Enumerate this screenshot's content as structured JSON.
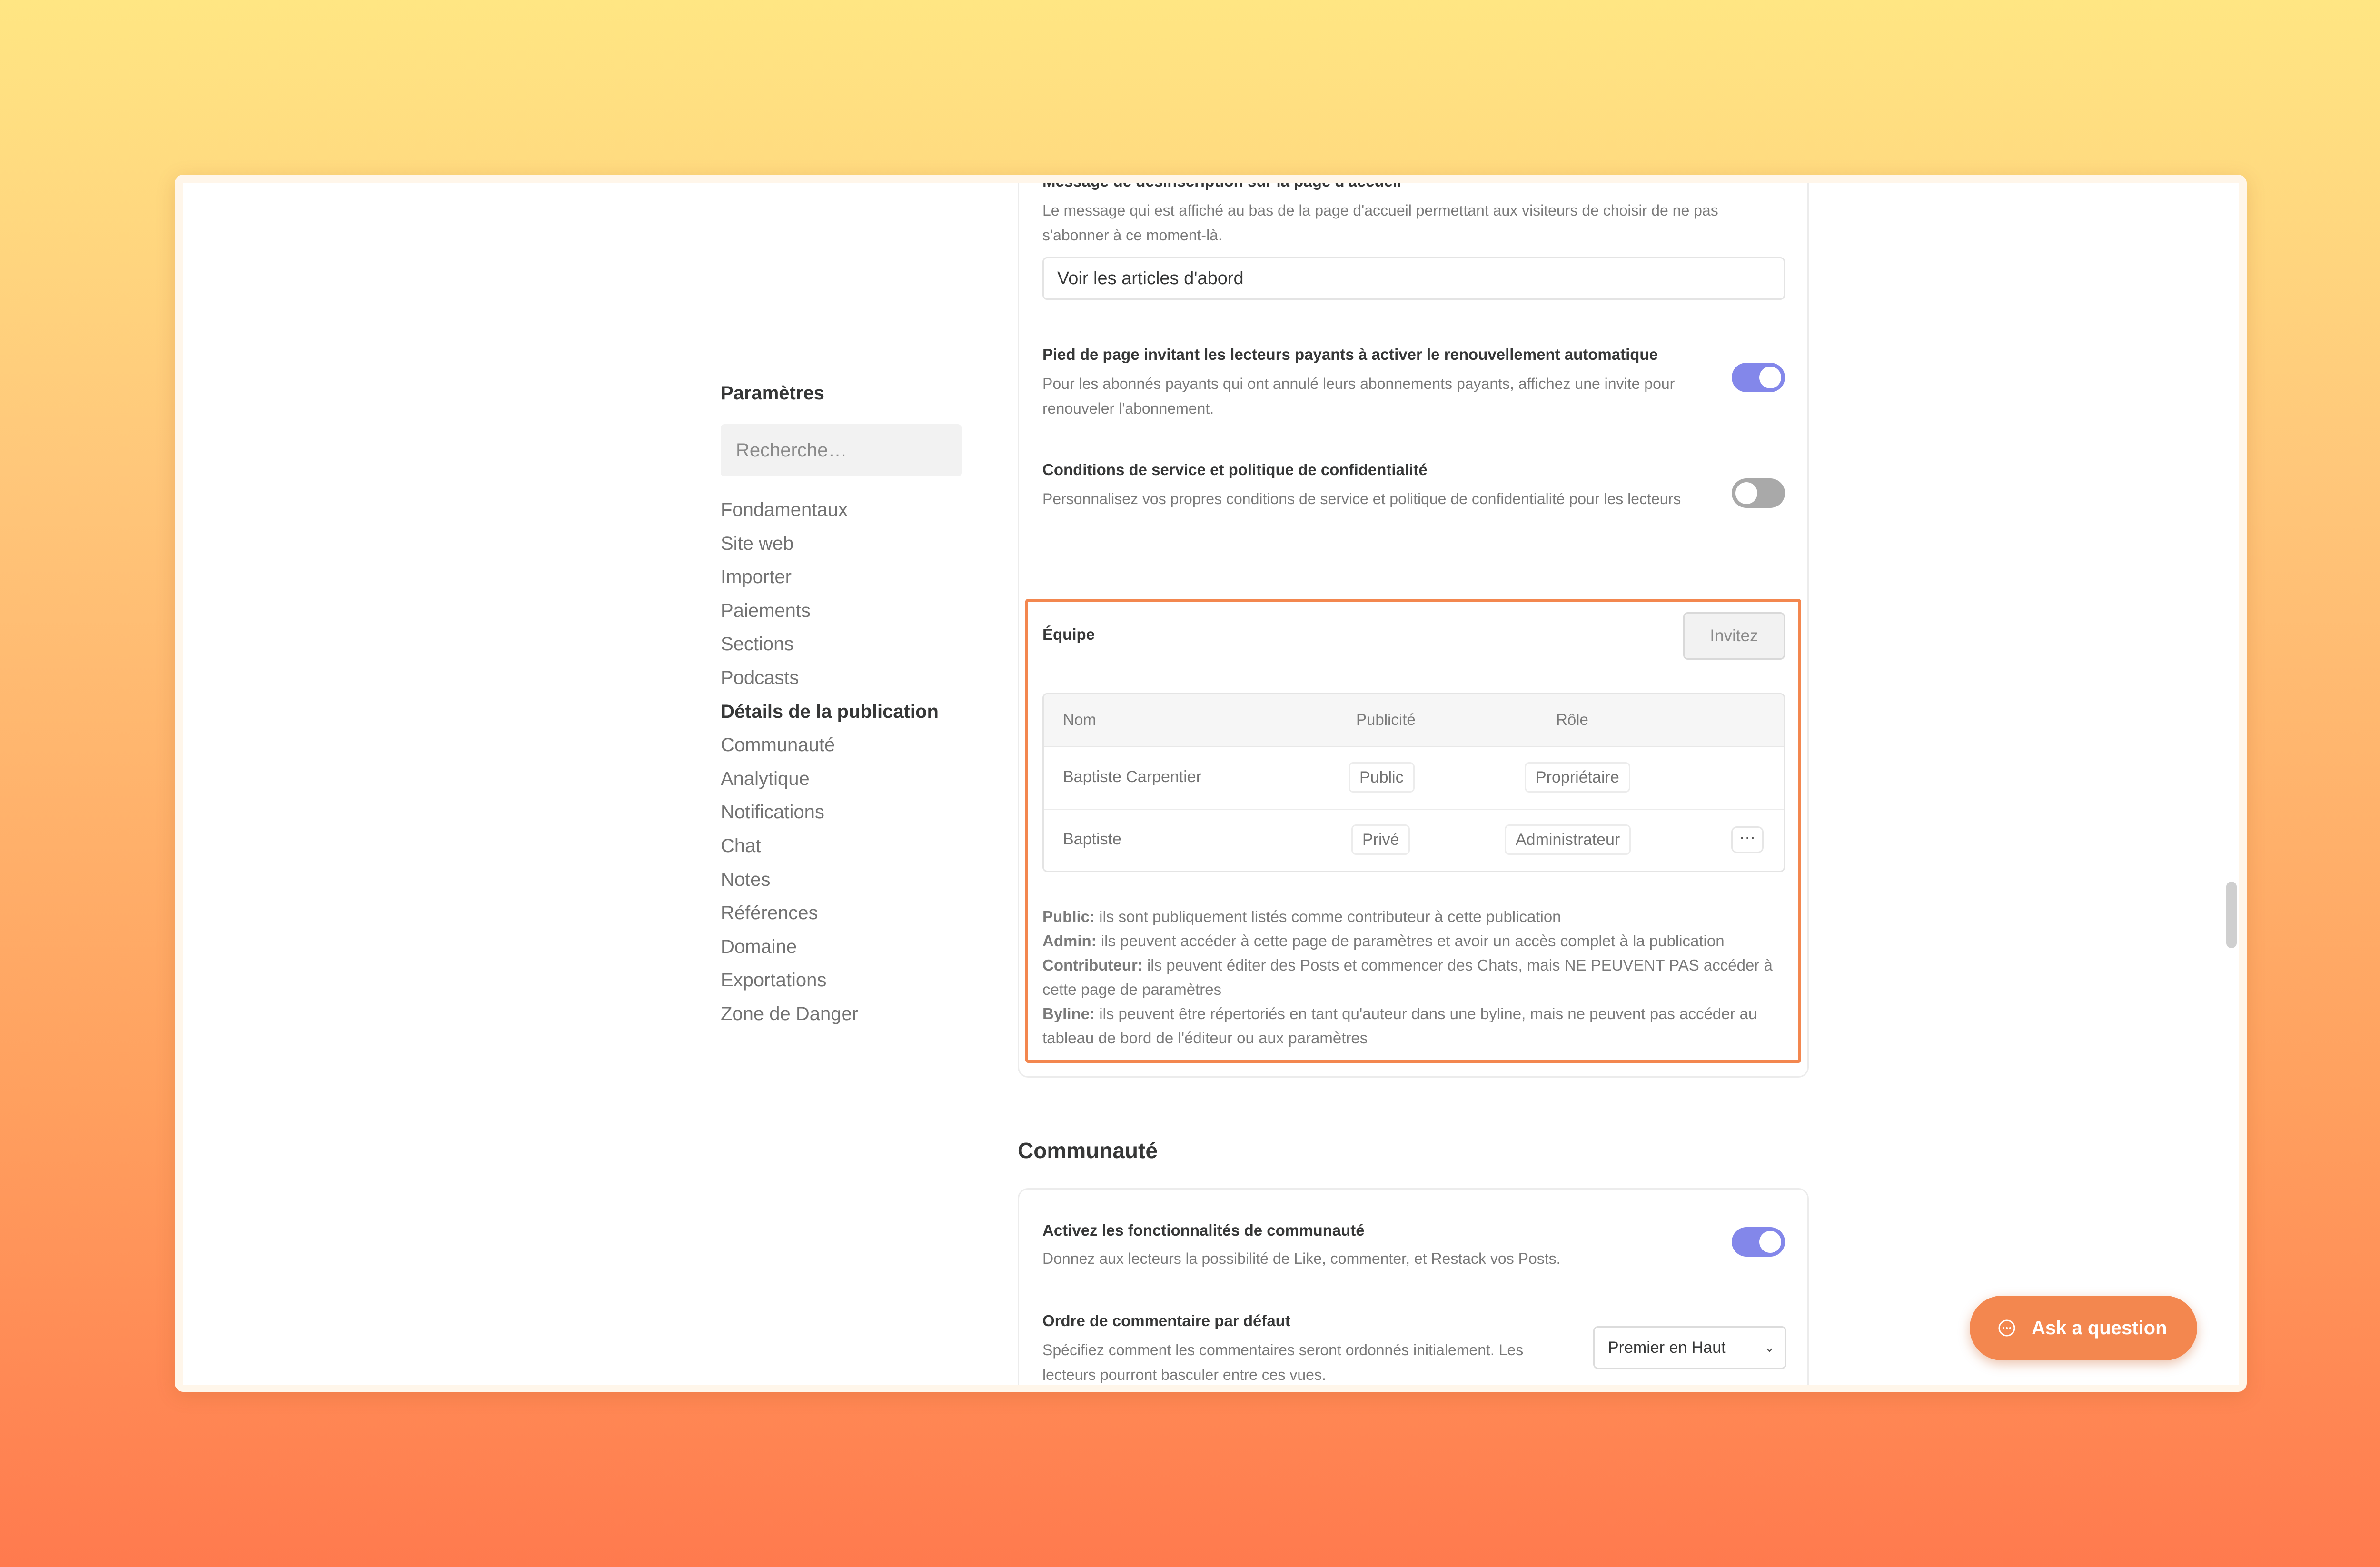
{
  "sidebar": {
    "title": "Paramètres",
    "search_placeholder": "Recherche…",
    "items": [
      {
        "label": "Fondamentaux"
      },
      {
        "label": "Site web"
      },
      {
        "label": "Importer"
      },
      {
        "label": "Paiements"
      },
      {
        "label": "Sections"
      },
      {
        "label": "Podcasts"
      },
      {
        "label": "Détails de la publication"
      },
      {
        "label": "Communauté"
      },
      {
        "label": "Analytique"
      },
      {
        "label": "Notifications"
      },
      {
        "label": "Chat"
      },
      {
        "label": "Notes"
      },
      {
        "label": "Références"
      },
      {
        "label": "Domaine"
      },
      {
        "label": "Exportations"
      },
      {
        "label": "Zone de Danger"
      }
    ],
    "active_item": "Détails de la publication"
  },
  "publication": {
    "unsubscribe_title": "Message de désinscription sur la page d'accueil",
    "unsubscribe_desc": "Le message qui est affiché au bas de la page d'accueil permettant aux visiteurs de choisir de ne pas s'abonner à ce moment-là.",
    "unsubscribe_value": "Voir les articles d'abord",
    "renewal_title": "Pied de page invitant les lecteurs payants à activer le renouvellement automatique",
    "renewal_desc": "Pour les abonnés payants qui ont annulé leurs abonnements payants, affichez une invite pour renouveler l'abonnement.",
    "renewal_enabled": true,
    "terms_title": "Conditions de service et politique de confidentialité",
    "terms_desc": "Personnalisez vos propres conditions de service et politique de confidentialité pour les lecteurs",
    "terms_enabled": false
  },
  "team": {
    "title": "Équipe",
    "invite_label": "Invitez",
    "columns": [
      "Nom",
      "Publicité",
      "Rôle"
    ],
    "rows": [
      {
        "name": "Baptiste Carpentier",
        "visibility": "Public",
        "role": "Propriétaire"
      },
      {
        "name": "Baptiste",
        "visibility": "Privé",
        "role": "Administrateur",
        "more": "···"
      }
    ],
    "legend": [
      {
        "term": "Public:",
        "text": " ils sont publiquement listés comme contributeur à cette publication"
      },
      {
        "term": "Admin:",
        "text": " ils peuvent accéder à cette page de paramètres et avoir un accès complet à la publication"
      },
      {
        "term": "Contributeur:",
        "text": " ils peuvent éditer des Posts et commencer des Chats, mais NE PEUVENT PAS accéder à cette page de paramètres"
      },
      {
        "term": "Byline:",
        "text": " ils peuvent être répertoriés en tant qu'auteur dans une byline, mais ne peuvent pas accéder au tableau de bord de l'éditeur ou aux paramètres"
      }
    ]
  },
  "community": {
    "section_title": "Communauté",
    "features_title": "Activez les fonctionnalités de communauté",
    "features_desc": "Donnez aux lecteurs la possibilité de Like, commenter, et Restack vos Posts.",
    "features_enabled": true,
    "order_title": "Ordre de commentaire par défaut",
    "order_desc": "Spécifiez comment les commentaires seront ordonnés initialement. Les lecteurs pourront basculer entre ces vues.",
    "order_value": "Premier en Haut"
  },
  "ask_button": {
    "label": "Ask a question"
  },
  "icons": {
    "ask": "chat-bubble-icon",
    "more": "ellipsis-icon",
    "select": "chevron-down-icon"
  },
  "colors": {
    "accent": "#f3874f",
    "toggle_on": "#8387ea",
    "toggle_off": "#a9a9a9"
  }
}
